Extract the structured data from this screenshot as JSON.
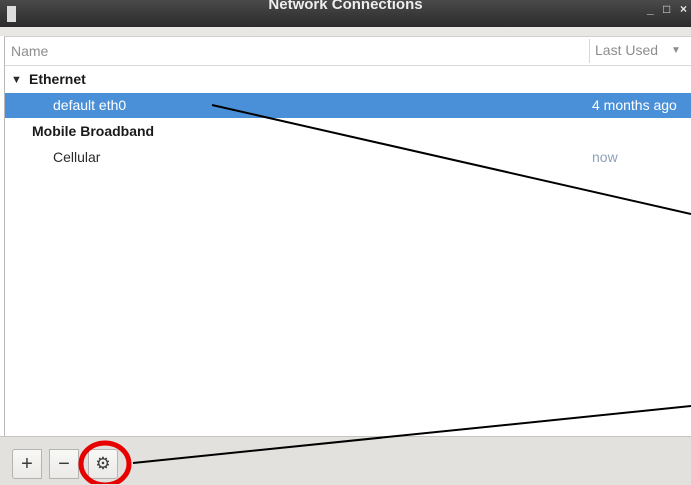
{
  "window": {
    "title": "Network Connections",
    "controls": [
      "_",
      "□",
      "×"
    ]
  },
  "table": {
    "col_name": "Name",
    "col_last_used": "Last Used",
    "sort_icon": "sort-descending-icon"
  },
  "groups": [
    {
      "label": "Ethernet",
      "expander_glyph": "▼",
      "connections": [
        {
          "name": "default eth0",
          "last_used": "4 months ago",
          "selected": true
        }
      ]
    },
    {
      "label": "Mobile Broadband",
      "connections": [
        {
          "name": "Cellular",
          "last_used": "now",
          "selected": false
        }
      ]
    }
  ],
  "toolbar": {
    "add_label": "+",
    "remove_label": "−",
    "settings_icon": "gear-icon",
    "settings_glyph": "⚙"
  },
  "annotations": {
    "color": "#e60000",
    "line_color": "#000000"
  },
  "colors": {
    "selection": "#4a90d9",
    "titlebar": "#2b2b2b"
  }
}
